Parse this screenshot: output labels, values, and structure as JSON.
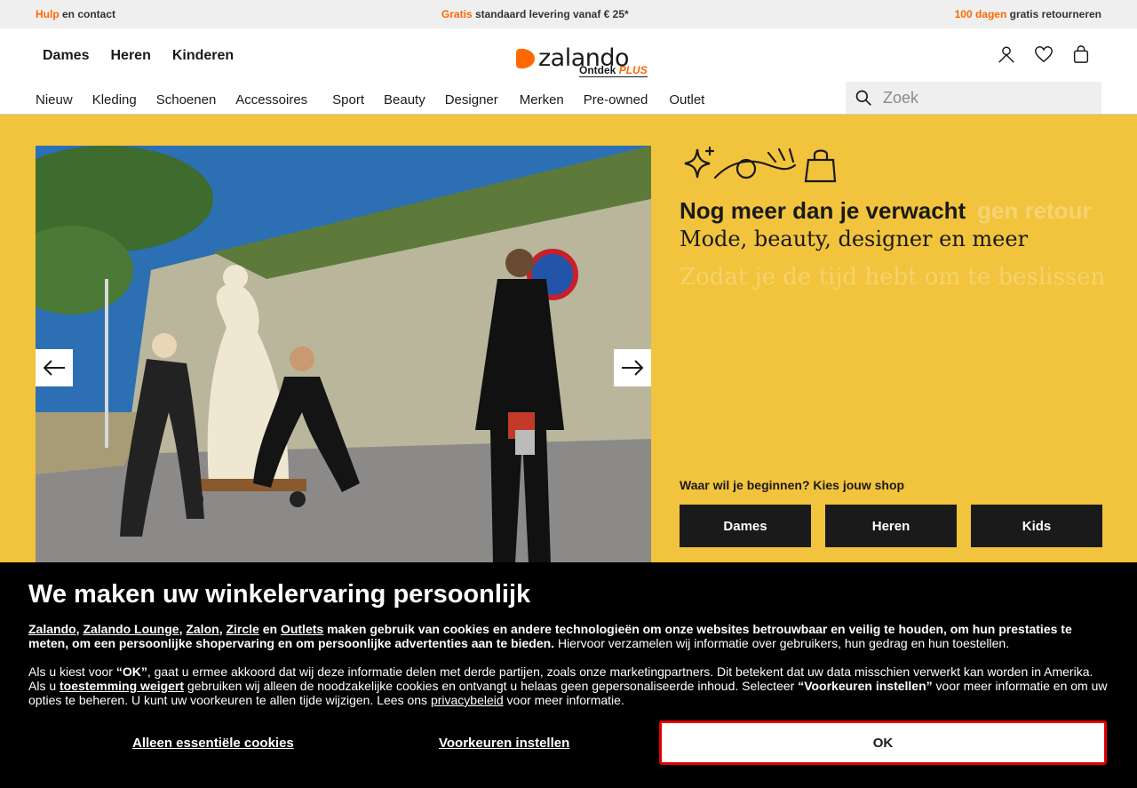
{
  "infobar": {
    "left_accent": "Hulp",
    "left_text": " en contact",
    "center_accent": "Gratis",
    "center_text": " standaard levering vanaf € 25*",
    "right_accent": "100 dagen",
    "right_text": " gratis retourneren"
  },
  "header": {
    "gender_nav": [
      "Dames",
      "Heren",
      "Kinderen"
    ],
    "logo_text": "zalando",
    "logo_sub": "Ontdek",
    "logo_plus": "PLUS",
    "categories": [
      "Nieuw",
      "Kleding",
      "Schoenen",
      "Accessoires",
      "Sport",
      "Beauty",
      "Designer",
      "Merken",
      "Pre-owned",
      "Outlet"
    ],
    "search_placeholder": "Zoek"
  },
  "hero": {
    "headline": "Nog meer dan je verwacht",
    "headline_ghost": "gen retour",
    "subline": "Mode, beauty, designer en meer",
    "ghost_line": "Zodat je de tijd hebt om te beslissen",
    "shop_question": "Waar wil je beginnen? Kies jouw shop",
    "shop_buttons": [
      "Dames",
      "Heren",
      "Kids"
    ]
  },
  "cookie": {
    "title": "We maken uw winkelervaring persoonlijk",
    "links": {
      "zalando": "Zalando",
      "lounge": "Zalando Lounge",
      "zalon": "Zalon",
      "zircle": "Zircle",
      "outlets": "Outlets",
      "refuse": "toestemming weigert",
      "privacy": "privacybeleid"
    },
    "p1_and": " en ",
    "p1_bold": " maken gebruik van cookies en andere technologieën om onze websites betrouwbaar en veilig te houden, om hun prestaties te meten, om een persoonlijke shopervaring en om persoonlijke advertenties aan te bieden.",
    "p1_rest": " Hiervoor verzamelen wij informatie over gebruikers, hun gedrag en hun toestellen.",
    "p2_a": "Als u kiest voor ",
    "p2_ok": "“OK”",
    "p2_b": ", gaat u ermee akkoord dat wij deze informatie delen met derde partijen, zoals onze marketingpartners. Dit betekent dat uw data misschien verwerkt kan worden in Amerika. Als u ",
    "p2_c": " gebruiken wij alleen de noodzakelijke cookies en ontvangt u helaas geen gepersonaliseerde inhoud. Selecteer ",
    "p2_pref": "“Voorkeuren instellen”",
    "p2_d": " voor meer informatie en om uw opties te beheren. U kunt uw voorkeuren te allen tijde wijzigen. Lees ons ",
    "p2_e": " voor meer informatie.",
    "btn_essential": "Alleen essentiële cookies",
    "btn_prefs": "Voorkeuren instellen",
    "btn_ok": "OK"
  },
  "colors": {
    "accent": "#ff6900",
    "hero_bg": "#f2c33d",
    "ok_border": "#e50000"
  }
}
